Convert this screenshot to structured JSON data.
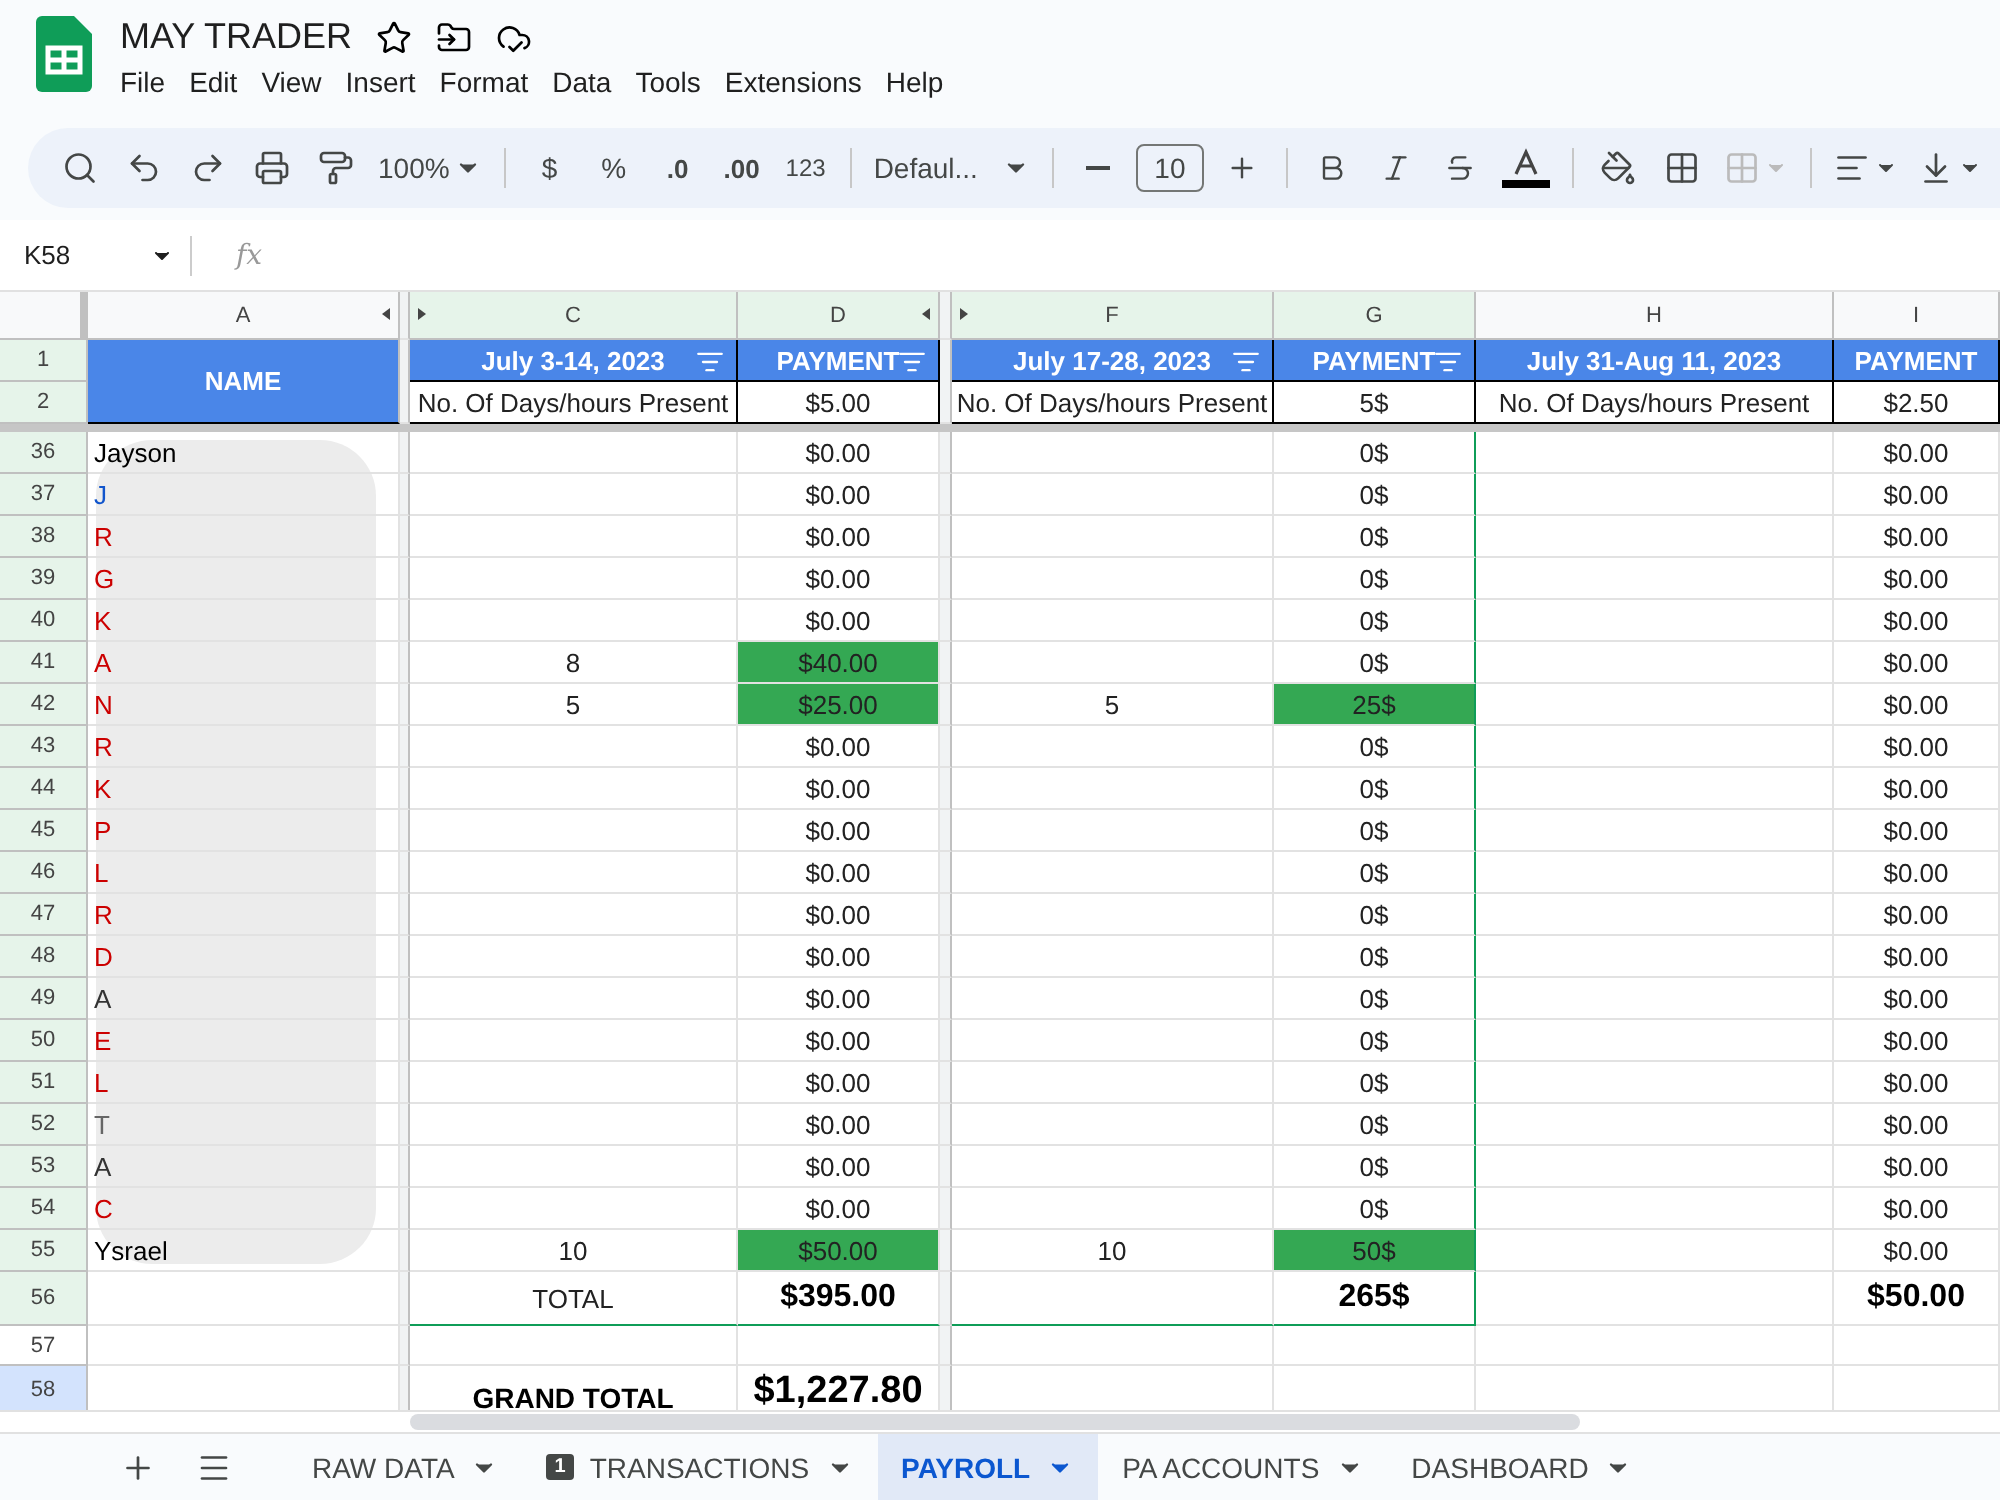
{
  "document": {
    "title": "MAY TRADER"
  },
  "menu": [
    "File",
    "Edit",
    "View",
    "Insert",
    "Format",
    "Data",
    "Tools",
    "Extensions",
    "Help"
  ],
  "toolbar": {
    "zoom": "100%",
    "currency": "$",
    "percent": "%",
    "decrease_decimals": ".0",
    "increase_decimals": ".00",
    "number_format": "123",
    "font": "Defaul...",
    "font_size": "10"
  },
  "formula_bar": {
    "cell_ref": "K58",
    "fx_label": "fx"
  },
  "header_rows": [
    {
      "num": "1"
    },
    {
      "num": "2"
    }
  ],
  "columns": [
    {
      "letter": "A",
      "in_range": false
    },
    {
      "letter": "C",
      "in_range": true
    },
    {
      "letter": "D",
      "in_range": true
    },
    {
      "letter": "F",
      "in_range": true
    },
    {
      "letter": "G",
      "in_range": true
    },
    {
      "letter": "H",
      "in_range": false
    },
    {
      "letter": "I",
      "in_range": false
    }
  ],
  "header": {
    "name": "NAME",
    "periods": [
      {
        "title": "July 3-14, 2023",
        "filter": true,
        "subtitle": "No. Of Days/hours Present",
        "payment": "PAYMENT",
        "payment_filter": true,
        "rate": "$5.00"
      },
      {
        "title": "July 17-28, 2023",
        "filter": true,
        "subtitle": "No. Of Days/hours Present",
        "payment": "PAYMENT",
        "payment_filter": true,
        "rate": "5$"
      },
      {
        "title": "July 31-Aug 11, 2023",
        "filter": false,
        "subtitle": "No. Of Days/hours Present",
        "payment": "PAYMENT",
        "payment_filter": false,
        "rate": "$2.50"
      }
    ]
  },
  "rows": [
    {
      "num": "36",
      "name": "Jayson",
      "color": "#000000",
      "cells": [
        {},
        {
          "value": "$0.00",
          "highlighted": false
        },
        {},
        {
          "value": "0$",
          "highlighted": false
        },
        {},
        {
          "value": "$0.00",
          "highlighted": false
        }
      ]
    },
    {
      "num": "37",
      "name": "J",
      "color": "#1155cc",
      "cells": [
        {},
        {
          "value": "$0.00",
          "highlighted": false
        },
        {},
        {
          "value": "0$",
          "highlighted": false
        },
        {},
        {
          "value": "$0.00",
          "highlighted": false
        }
      ]
    },
    {
      "num": "38",
      "name": "R",
      "color": "#cc0000",
      "cells": [
        {},
        {
          "value": "$0.00",
          "highlighted": false
        },
        {},
        {
          "value": "0$",
          "highlighted": false
        },
        {},
        {
          "value": "$0.00",
          "highlighted": false
        }
      ]
    },
    {
      "num": "39",
      "name": "G",
      "color": "#cc0000",
      "cells": [
        {},
        {
          "value": "$0.00",
          "highlighted": false
        },
        {},
        {
          "value": "0$",
          "highlighted": false
        },
        {},
        {
          "value": "$0.00",
          "highlighted": false
        }
      ]
    },
    {
      "num": "40",
      "name": "K",
      "color": "#cc0000",
      "cells": [
        {},
        {
          "value": "$0.00",
          "highlighted": false
        },
        {},
        {
          "value": "0$",
          "highlighted": false
        },
        {},
        {
          "value": "$0.00",
          "highlighted": false
        }
      ]
    },
    {
      "num": "41",
      "name": "A",
      "color": "#cc0000",
      "cells": [
        {
          "value": "8"
        },
        {
          "value": "$40.00",
          "highlighted": true
        },
        {},
        {
          "value": "0$",
          "highlighted": false
        },
        {},
        {
          "value": "$0.00",
          "highlighted": false
        }
      ]
    },
    {
      "num": "42",
      "name": "N",
      "color": "#cc0000",
      "cells": [
        {
          "value": "5"
        },
        {
          "value": "$25.00",
          "highlighted": true
        },
        {
          "value": "5"
        },
        {
          "value": "25$",
          "highlighted": true
        },
        {},
        {
          "value": "$0.00",
          "highlighted": false
        }
      ]
    },
    {
      "num": "43",
      "name": "R",
      "color": "#cc0000",
      "cells": [
        {},
        {
          "value": "$0.00",
          "highlighted": false
        },
        {},
        {
          "value": "0$",
          "highlighted": false
        },
        {},
        {
          "value": "$0.00",
          "highlighted": false
        }
      ]
    },
    {
      "num": "44",
      "name": "K",
      "color": "#cc0000",
      "cells": [
        {},
        {
          "value": "$0.00",
          "highlighted": false
        },
        {},
        {
          "value": "0$",
          "highlighted": false
        },
        {},
        {
          "value": "$0.00",
          "highlighted": false
        }
      ]
    },
    {
      "num": "45",
      "name": "P",
      "color": "#cc0000",
      "cells": [
        {},
        {
          "value": "$0.00",
          "highlighted": false
        },
        {},
        {
          "value": "0$",
          "highlighted": false
        },
        {},
        {
          "value": "$0.00",
          "highlighted": false
        }
      ]
    },
    {
      "num": "46",
      "name": "L",
      "color": "#cc0000",
      "cells": [
        {},
        {
          "value": "$0.00",
          "highlighted": false
        },
        {},
        {
          "value": "0$",
          "highlighted": false
        },
        {},
        {
          "value": "$0.00",
          "highlighted": false
        }
      ]
    },
    {
      "num": "47",
      "name": "R",
      "color": "#cc0000",
      "cells": [
        {},
        {
          "value": "$0.00",
          "highlighted": false
        },
        {},
        {
          "value": "0$",
          "highlighted": false
        },
        {},
        {
          "value": "$0.00",
          "highlighted": false
        }
      ]
    },
    {
      "num": "48",
      "name": "D",
      "color": "#cc0000",
      "cells": [
        {},
        {
          "value": "$0.00",
          "highlighted": false
        },
        {},
        {
          "value": "0$",
          "highlighted": false
        },
        {},
        {
          "value": "$0.00",
          "highlighted": false
        }
      ]
    },
    {
      "num": "49",
      "name": "A",
      "color": "#333333",
      "cells": [
        {},
        {
          "value": "$0.00",
          "highlighted": false
        },
        {},
        {
          "value": "0$",
          "highlighted": false
        },
        {},
        {
          "value": "$0.00",
          "highlighted": false
        }
      ]
    },
    {
      "num": "50",
      "name": "E",
      "color": "#cc0000",
      "cells": [
        {},
        {
          "value": "$0.00",
          "highlighted": false
        },
        {},
        {
          "value": "0$",
          "highlighted": false
        },
        {},
        {
          "value": "$0.00",
          "highlighted": false
        }
      ]
    },
    {
      "num": "51",
      "name": "L",
      "color": "#cc0000",
      "cells": [
        {},
        {
          "value": "$0.00",
          "highlighted": false
        },
        {},
        {
          "value": "0$",
          "highlighted": false
        },
        {},
        {
          "value": "$0.00",
          "highlighted": false
        }
      ]
    },
    {
      "num": "52",
      "name": "T",
      "color": "#666666",
      "cells": [
        {},
        {
          "value": "$0.00",
          "highlighted": false
        },
        {},
        {
          "value": "0$",
          "highlighted": false
        },
        {},
        {
          "value": "$0.00",
          "highlighted": false
        }
      ]
    },
    {
      "num": "53",
      "name": "A",
      "color": "#333333",
      "cells": [
        {},
        {
          "value": "$0.00",
          "highlighted": false
        },
        {},
        {
          "value": "0$",
          "highlighted": false
        },
        {},
        {
          "value": "$0.00",
          "highlighted": false
        }
      ]
    },
    {
      "num": "54",
      "name": "C",
      "color": "#cc0000",
      "cells": [
        {},
        {
          "value": "$0.00",
          "highlighted": false
        },
        {},
        {
          "value": "0$",
          "highlighted": false
        },
        {},
        {
          "value": "$0.00",
          "highlighted": false
        }
      ]
    },
    {
      "num": "55",
      "name": "Ysrael",
      "color": "#000000",
      "cells": [
        {
          "value": "10"
        },
        {
          "value": "$50.00",
          "highlighted": true
        },
        {
          "value": "10"
        },
        {
          "value": "50$",
          "highlighted": true
        },
        {},
        {
          "value": "$0.00",
          "highlighted": false
        }
      ]
    }
  ],
  "totals": {
    "num": "56",
    "label": "TOTAL",
    "values": [
      "$395.00",
      "265$",
      "$50.00"
    ]
  },
  "blank_row": {
    "num": "57"
  },
  "grand_total": {
    "num": "58",
    "selected": true,
    "label": "GRAND TOTAL",
    "value": "$1,227.80"
  },
  "sheet_tabs": [
    {
      "label": "RAW DATA",
      "selected": false
    },
    {
      "label": "TRANSACTIONS",
      "selected": false,
      "badge": "1"
    },
    {
      "label": "PAYROLL",
      "selected": true
    },
    {
      "label": "PA ACCOUNTS",
      "selected": false
    },
    {
      "label": "DASHBOARD",
      "selected": false
    }
  ]
}
